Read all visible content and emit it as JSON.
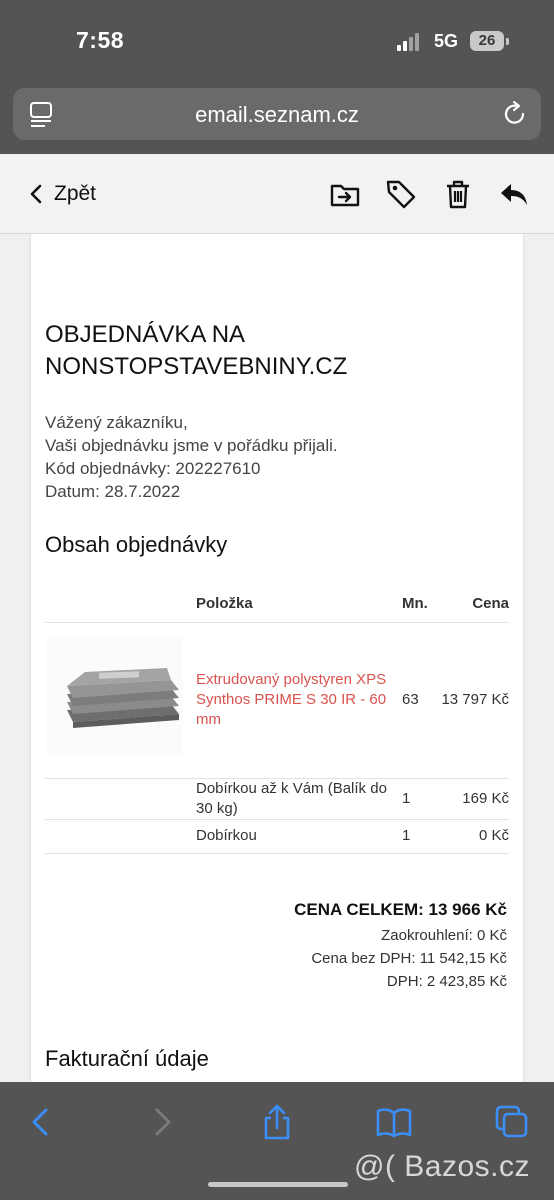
{
  "status_bar": {
    "time": "7:58",
    "network": "5G",
    "battery": "26"
  },
  "browser": {
    "url": "email.seznam.cz"
  },
  "toolbar": {
    "back_label": "Zpět",
    "icons": [
      "move-to-folder-icon",
      "tag-icon",
      "trash-icon",
      "reply-icon"
    ]
  },
  "email": {
    "title_line1": "OBJEDNÁVKA NA",
    "title_line2": "NONSTOPSTAVEBNINY.CZ",
    "greeting": "Vážený zákazníku,",
    "message": "Vaši objednávku jsme v pořádku přijali.",
    "order_code": "Kód objednávky: 202227610",
    "date": "Datum: 28.7.2022",
    "section_order": "Obsah objednávky",
    "table": {
      "headers": {
        "item": "Položka",
        "qty": "Mn.",
        "price": "Cena"
      },
      "rows": [
        {
          "name": "Extrudovaný polystyren XPS Synthos PRIME S 30 IR - 60 mm",
          "qty": "63",
          "price": "13 797 Kč",
          "is_link": true
        },
        {
          "name": "Dobírkou až k Vám (Balík do 30 kg)",
          "qty": "1",
          "price": "169 Kč",
          "is_link": false
        },
        {
          "name": "Dobírkou",
          "qty": "1",
          "price": "0 Kč",
          "is_link": false
        }
      ]
    },
    "totals": {
      "total": "CENA CELKEM: 13 966 Kč",
      "rounding": "Zaokrouhlení: 0 Kč",
      "net": "Cena bez DPH: 11 542,15 Kč",
      "vat": "DPH: 2 423,85 Kč"
    },
    "section_billing": "Fakturační údaje"
  },
  "bottom_bar": {
    "icons": [
      "back-arrow-icon",
      "forward-arrow-icon",
      "share-icon",
      "bookmarks-icon",
      "tabs-icon"
    ]
  },
  "watermark": "@( Bazos.cz",
  "colors": {
    "chrome": "#545454",
    "link_red": "#d9534f",
    "ios_blue": "#3a8ef6"
  }
}
